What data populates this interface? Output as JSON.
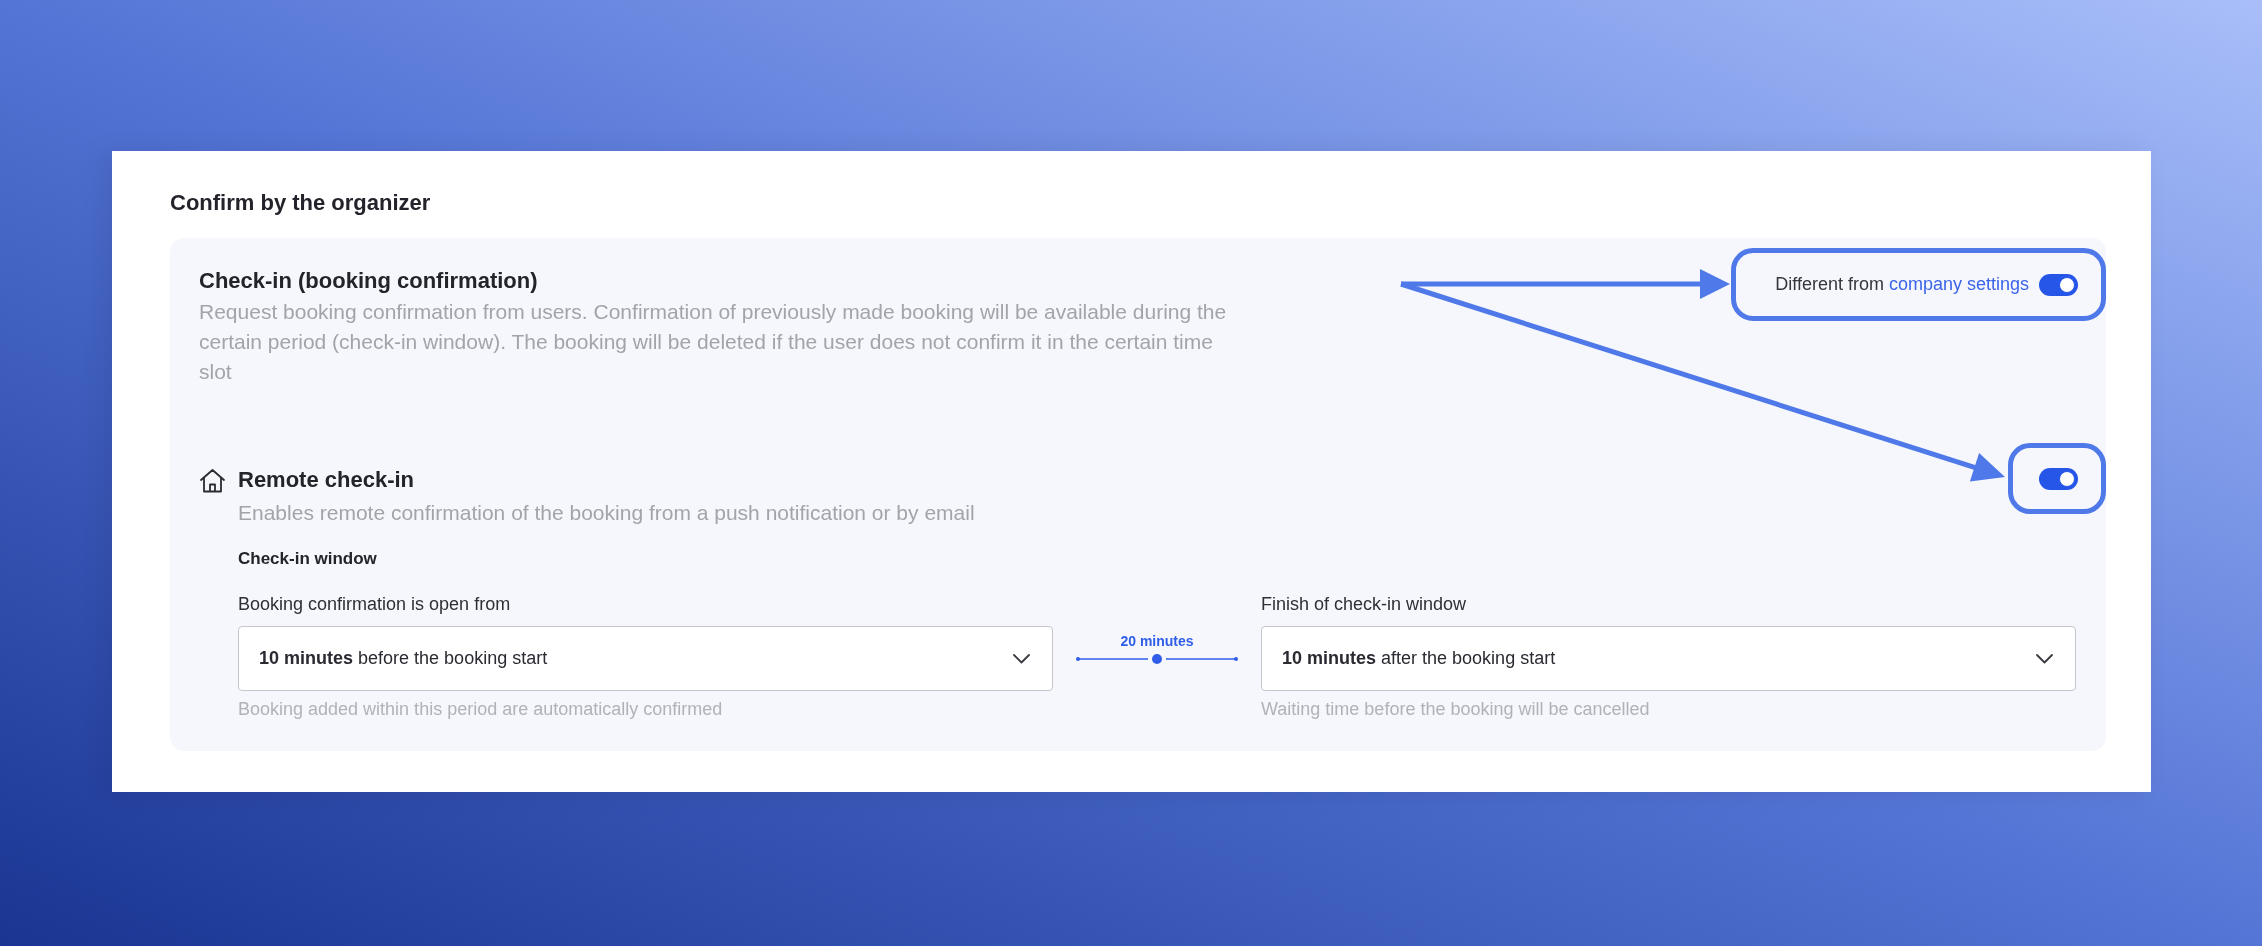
{
  "section": {
    "title": "Confirm by the organizer"
  },
  "check_in": {
    "title": "Check-in (booking confirmation)",
    "description": "Request booking confirmation from users. Confirmation of previously made booking will be available during the certain period (check-in window). The booking will be deleted if the user does not confirm it in the certain time slot",
    "override": {
      "label": "Different from",
      "link": "company settings",
      "on": true
    }
  },
  "remote_check_in": {
    "title": "Remote check-in",
    "description": "Enables remote confirmation of the booking from a push notification or by email",
    "on": true
  },
  "check_in_window": {
    "title": "Check-in window",
    "duration": "20 minutes",
    "fields": [
      {
        "label": "Booking confirmation is open from",
        "value": "**10 minutes** before the booking start",
        "hint": "Booking added within this period are automatically confirmed"
      },
      {
        "label": "Finish of check-in window",
        "value": "**10 minutes** after the booking start",
        "hint": "Waiting time before the booking will be cancelled"
      }
    ]
  }
}
